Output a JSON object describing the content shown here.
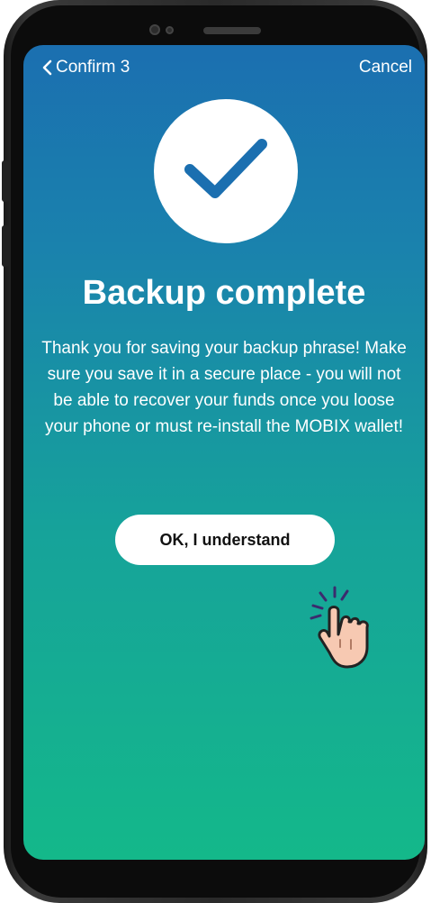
{
  "header": {
    "back_label": "Confirm 3",
    "cancel_label": "Cancel"
  },
  "title": "Backup complete",
  "message": "Thank you for saving your backup phrase! Make sure you save it in a secure place - you will not be able to recover your funds once you loose your phone or must re-install the MOBIX wallet!",
  "ok_button": "OK, I understand",
  "icons": {
    "back": "chevron-left-icon",
    "success": "check-icon",
    "pointer": "tap-hand-icon"
  },
  "colors": {
    "gradient_top": "#1b6fb0",
    "gradient_bottom": "#14b88a",
    "check": "#1b6fb0"
  }
}
